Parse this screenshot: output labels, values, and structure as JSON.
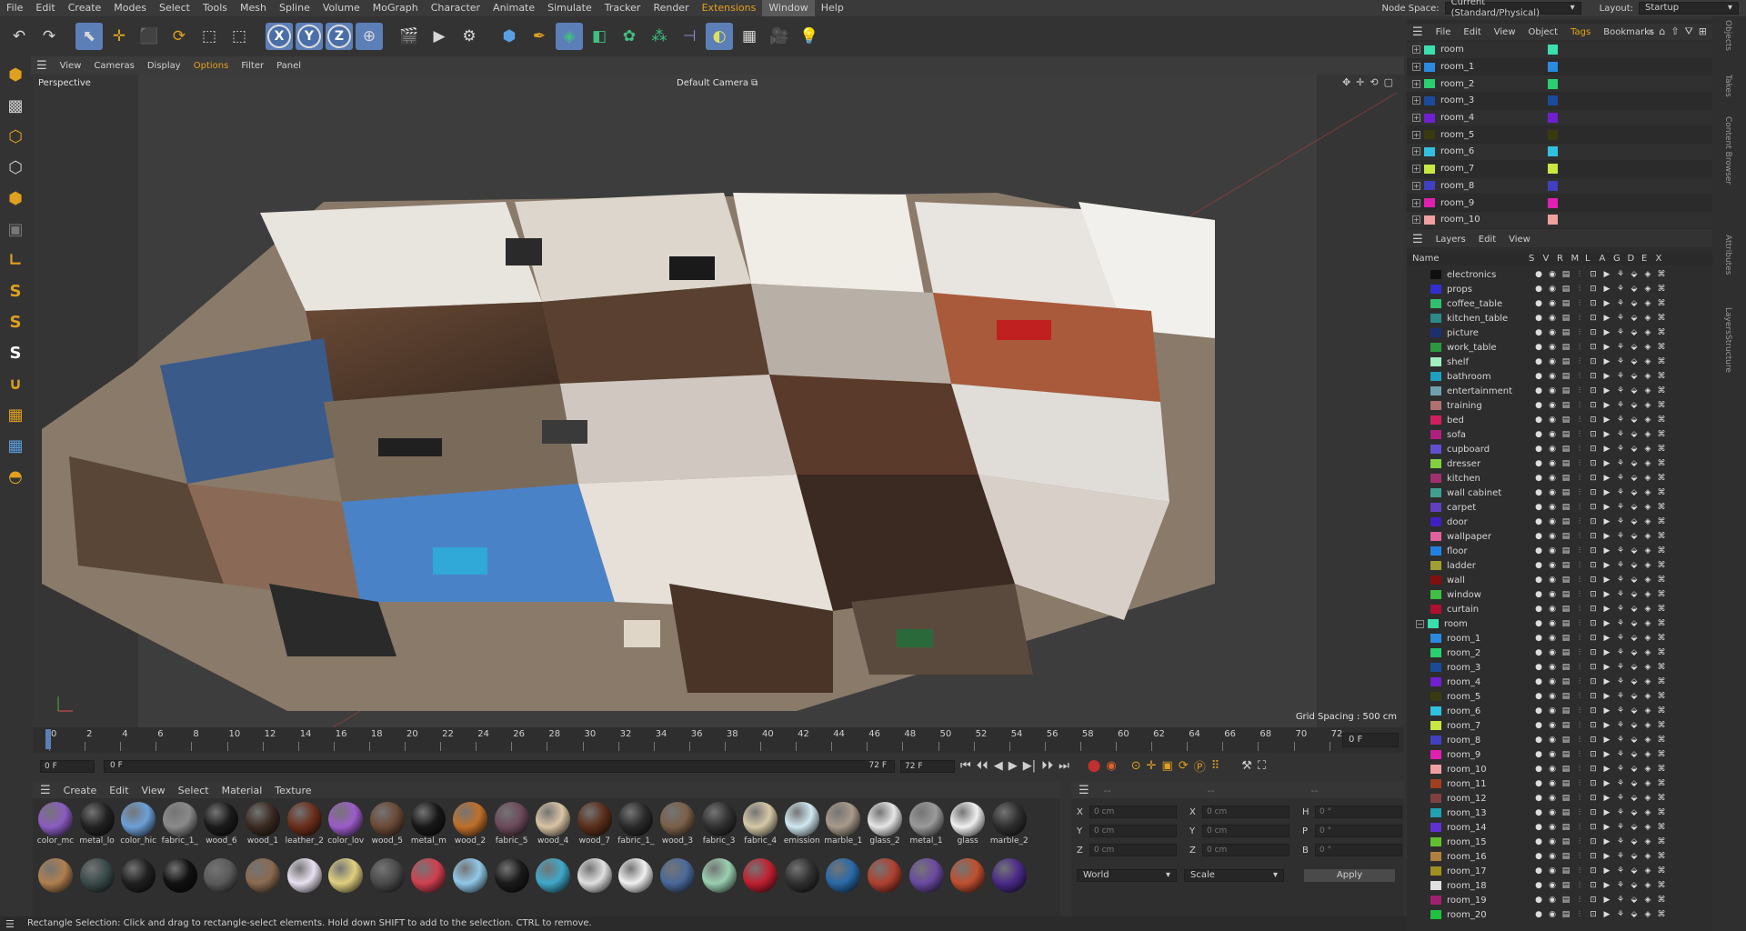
{
  "menu": {
    "items": [
      "File",
      "Edit",
      "Create",
      "Modes",
      "Select",
      "Tools",
      "Mesh",
      "Spline",
      "Volume",
      "MoGraph",
      "Character",
      "Animate",
      "Simulate",
      "Tracker",
      "Render",
      "Extensions",
      "Window",
      "Help"
    ],
    "node_space_label": "Node Space:",
    "node_space_value": "Current (Standard/Physical)",
    "layout_label": "Layout:",
    "layout_value": "Startup"
  },
  "toolbar": {
    "icons": [
      "undo-icon",
      "redo-icon",
      "select-arrow-icon",
      "move-icon",
      "scale-icon",
      "rotate-icon",
      "last-tool-icon",
      "recent-icon",
      "x-axis-icon",
      "y-axis-icon",
      "z-axis-icon",
      "world-coord-icon",
      "render-region-icon",
      "render-view-icon",
      "render-settings-icon",
      "cube-icon",
      "pen-icon",
      "subdivision-icon",
      "extrude-icon",
      "cloner-icon",
      "array-icon",
      "bend-icon",
      "scene-icon",
      "floor-icon",
      "camera-icon",
      "light-icon"
    ],
    "axis_labels": [
      "X",
      "Y",
      "Z"
    ]
  },
  "viewport": {
    "menu": [
      "View",
      "Cameras",
      "Display",
      "Options",
      "Filter",
      "Panel"
    ],
    "name": "Perspective",
    "camera": "Default Camera",
    "grid_spacing": "Grid Spacing : 500 cm"
  },
  "timeline": {
    "ticks": [
      "0",
      "2",
      "4",
      "6",
      "8",
      "10",
      "12",
      "14",
      "16",
      "18",
      "20",
      "22",
      "24",
      "26",
      "28",
      "30",
      "32",
      "34",
      "36",
      "38",
      "40",
      "42",
      "44",
      "46",
      "48",
      "50",
      "52",
      "54",
      "56",
      "58",
      "60",
      "62",
      "64",
      "66",
      "68",
      "70",
      "72"
    ],
    "current": "0 F",
    "start": "0 F",
    "range_start": "0 F",
    "range_end": "72 F",
    "end": "72 F"
  },
  "materials": {
    "menu": [
      "Create",
      "Edit",
      "View",
      "Select",
      "Material",
      "Texture"
    ],
    "row1": [
      {
        "label": "color_mc",
        "color": "#8a5cc0"
      },
      {
        "label": "metal_lo",
        "color": "#222"
      },
      {
        "label": "color_hic",
        "color": "#6ca0d8"
      },
      {
        "label": "fabric_1_",
        "color": "#8a8a8a"
      },
      {
        "label": "wood_6",
        "color": "#1b1b1b"
      },
      {
        "label": "wood_1",
        "color": "#3a2a22"
      },
      {
        "label": "leather_2",
        "color": "#6a2e1a"
      },
      {
        "label": "color_lov",
        "color": "#9c5cc8"
      },
      {
        "label": "wood_5",
        "color": "#6b4a36"
      },
      {
        "label": "metal_m",
        "color": "#181818"
      },
      {
        "label": "wood_2",
        "color": "#c0702a"
      },
      {
        "label": "fabric_5",
        "color": "#6a4a5a"
      },
      {
        "label": "wood_4",
        "color": "#d9c4a4"
      },
      {
        "label": "wood_7",
        "color": "#5a2e1a"
      },
      {
        "label": "fabric_1_",
        "color": "#2a2a2a"
      },
      {
        "label": "wood_3",
        "color": "#7a6048"
      },
      {
        "label": "fabric_3",
        "color": "#303030"
      },
      {
        "label": "fabric_4",
        "color": "#d6c9a8"
      },
      {
        "label": "emission",
        "color": "#d0e8f0"
      },
      {
        "label": "marble_1",
        "color": "#a89a8a"
      },
      {
        "label": "glass_2",
        "color": "#e6e6e6"
      },
      {
        "label": "metal_1",
        "color": "#9a9a9a"
      },
      {
        "label": "glass",
        "color": "#f0f0f0"
      },
      {
        "label": "marble_2",
        "color": "#2e2e2e"
      }
    ],
    "row2": [
      {
        "color": "#b08050"
      },
      {
        "color": "#3a4a4a"
      },
      {
        "color": "#202020"
      },
      {
        "color": "#111"
      },
      {
        "color": "#5a5a5a"
      },
      {
        "color": "#8a6a50"
      },
      {
        "color": "#e8e0f0"
      },
      {
        "color": "#e0d080"
      },
      {
        "color": "#4a4a4a"
      },
      {
        "color": "#d04050"
      },
      {
        "color": "#90c8e8"
      },
      {
        "color": "#1a1a1a"
      },
      {
        "color": "#40a8c8"
      },
      {
        "color": "#e0e0e0"
      },
      {
        "color": "#f0f0f0"
      },
      {
        "color": "#4a6a9a"
      },
      {
        "color": "#9ad0b0"
      },
      {
        "color": "#c02030"
      },
      {
        "color": "#303030"
      },
      {
        "color": "#2a6aa8"
      },
      {
        "color": "#b04030"
      },
      {
        "color": "#6a4aa0"
      },
      {
        "color": "#c05030"
      },
      {
        "color": "#4a2a8a"
      }
    ]
  },
  "attributes": {
    "rows": [
      {
        "a": "X",
        "av": "0 cm",
        "b": "X",
        "bv": "0 cm",
        "c": "H",
        "cv": "0 °"
      },
      {
        "a": "Y",
        "av": "0 cm",
        "b": "Y",
        "bv": "0 cm",
        "c": "P",
        "cv": "0 °"
      },
      {
        "a": "Z",
        "av": "0 cm",
        "b": "Z",
        "bv": "0 cm",
        "c": "B",
        "cv": "0 °"
      }
    ],
    "world": "World",
    "scale": "Scale",
    "apply": "Apply",
    "header": "--"
  },
  "objects": {
    "menu": [
      "File",
      "Edit",
      "View",
      "Object",
      "Tags",
      "Bookmarks"
    ],
    "items": [
      {
        "name": "room",
        "color": "#3adfb0"
      },
      {
        "name": "room_1",
        "color": "#2a8ae0"
      },
      {
        "name": "room_2",
        "color": "#2ad070"
      },
      {
        "name": "room_3",
        "color": "#1a4a9a"
      },
      {
        "name": "room_4",
        "color": "#7020d0"
      },
      {
        "name": "room_5",
        "color": "#3a3a10"
      },
      {
        "name": "room_6",
        "color": "#30c0e0"
      },
      {
        "name": "room_7",
        "color": "#c8e840"
      },
      {
        "name": "room_8",
        "color": "#4040c0"
      },
      {
        "name": "room_9",
        "color": "#e020b0"
      },
      {
        "name": "room_10",
        "color": "#f0a0a0"
      }
    ]
  },
  "layers": {
    "menu": [
      "Layers",
      "Edit",
      "View"
    ],
    "columns": [
      "Name",
      "S",
      "V",
      "R",
      "M",
      "L",
      "A",
      "G",
      "D",
      "E",
      "X"
    ],
    "items": [
      {
        "name": "electronics",
        "color": "#101010"
      },
      {
        "name": "props",
        "color": "#3030d0"
      },
      {
        "name": "coffee_table",
        "color": "#30c070"
      },
      {
        "name": "kitchen_table",
        "color": "#2a8a8a"
      },
      {
        "name": "picture",
        "color": "#1a3070"
      },
      {
        "name": "work_table",
        "color": "#2a9a40"
      },
      {
        "name": "shelf",
        "color": "#a0f0c0"
      },
      {
        "name": "bathroom",
        "color": "#20a0c0"
      },
      {
        "name": "entertainment",
        "color": "#70a0b0"
      },
      {
        "name": "training",
        "color": "#b07070"
      },
      {
        "name": "bed",
        "color": "#d02060"
      },
      {
        "name": "sofa",
        "color": "#b02080"
      },
      {
        "name": "cupboard",
        "color": "#6050d0"
      },
      {
        "name": "dresser",
        "color": "#80d040"
      },
      {
        "name": "kitchen",
        "color": "#a03070"
      },
      {
        "name": "wall cabinet",
        "color": "#40a090"
      },
      {
        "name": "carpet",
        "color": "#6040c0"
      },
      {
        "name": "door",
        "color": "#4020c0"
      },
      {
        "name": "wallpaper",
        "color": "#e060a0"
      },
      {
        "name": "floor",
        "color": "#2080e0"
      },
      {
        "name": "ladder",
        "color": "#a0a030"
      },
      {
        "name": "wall",
        "color": "#801010"
      },
      {
        "name": "window",
        "color": "#40c040"
      },
      {
        "name": "curtain",
        "color": "#b01030"
      }
    ],
    "group": {
      "name": "room",
      "color": "#3adfb0"
    },
    "rooms": [
      {
        "name": "room_1",
        "color": "#2a8ae0"
      },
      {
        "name": "room_2",
        "color": "#2ad070"
      },
      {
        "name": "room_3",
        "color": "#1a4a9a"
      },
      {
        "name": "room_4",
        "color": "#7020d0"
      },
      {
        "name": "room_5",
        "color": "#3a3a10"
      },
      {
        "name": "room_6",
        "color": "#30c0e0"
      },
      {
        "name": "room_7",
        "color": "#c8e840"
      },
      {
        "name": "room_8",
        "color": "#4040c0"
      },
      {
        "name": "room_9",
        "color": "#e020b0"
      },
      {
        "name": "room_10",
        "color": "#f0a0a0"
      },
      {
        "name": "room_11",
        "color": "#a04020"
      },
      {
        "name": "room_12",
        "color": "#804040"
      },
      {
        "name": "room_13",
        "color": "#20a0b0"
      },
      {
        "name": "room_14",
        "color": "#6030d0"
      },
      {
        "name": "room_15",
        "color": "#60c030"
      },
      {
        "name": "room_16",
        "color": "#b08040"
      },
      {
        "name": "room_17",
        "color": "#a09020"
      },
      {
        "name": "room_18",
        "color": "#e0e0e0"
      },
      {
        "name": "room_19",
        "color": "#a02070"
      },
      {
        "name": "room_20",
        "color": "#20c040"
      }
    ]
  },
  "side_tabs": [
    "Objects",
    "Takes",
    "Content Browser",
    "Attributes",
    "Layers",
    "Structure"
  ],
  "status": "Rectangle Selection: Click and drag to rectangle-select elements. Hold down SHIFT to add to the selection. CTRL to remove."
}
